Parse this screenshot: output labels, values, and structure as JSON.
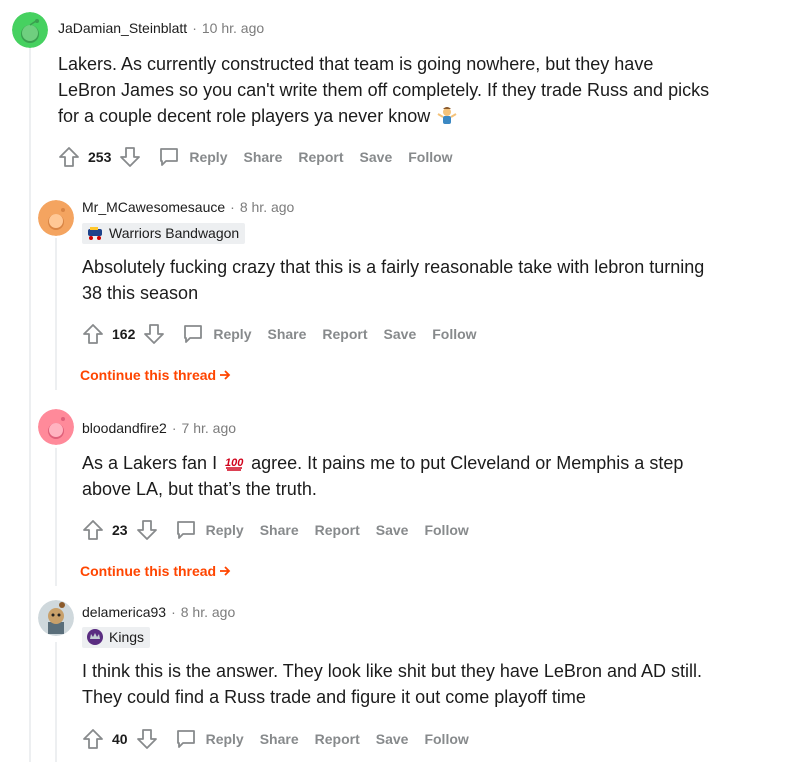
{
  "comments": [
    {
      "username": "JaDamian_Steinblatt",
      "time": "10 hr. ago",
      "body_lines": [
        "Lakers. As currently constructed that team is going nowhere, but they have",
        "LeBron James so you can't write them off completely. If they trade Russ and picks",
        "for a couple decent role players ya never know"
      ],
      "emoji": "person-shrugging-emoji",
      "score": "253",
      "avatar_color": "#46d160"
    },
    {
      "username": "Mr_MCawesomesauce",
      "time": "8 hr. ago",
      "flair": "Warriors Bandwagon",
      "flair_icon": "warriors-bandwagon-icon",
      "body_lines": [
        "Absolutely fucking crazy that this is a fairly reasonable take with lebron turning",
        "38 this season"
      ],
      "score": "162",
      "avatar_color": "#f4a460"
    },
    {
      "username": "bloodandfire2",
      "time": "7 hr. ago",
      "body_before_emoji": "As a Lakers fan I",
      "body_after_emoji": "agree. It pains me to put Cleveland or Memphis a step",
      "body_line2": "above LA, but that’s the truth.",
      "emoji": "hundred-points-emoji",
      "score": "23",
      "avatar_color": "#ff8a9a"
    },
    {
      "username": "delamerica93",
      "time": "8 hr. ago",
      "flair": "Kings",
      "flair_icon": "kings-logo-icon",
      "body_lines": [
        "I think this is the answer. They look like shit but they have LeBron and AD still.",
        "They could find a Russ trade and figure it out come playoff time"
      ],
      "score": "40",
      "avatar_color": "#cfd8dc"
    }
  ],
  "actions": {
    "reply": "Reply",
    "share": "Share",
    "report": "Report",
    "save": "Save",
    "follow": "Follow"
  },
  "continue_thread": "Continue this thread",
  "colors": {
    "accent": "#ff4500",
    "muted": "#878a8c",
    "thread_line": "#edeff1"
  }
}
